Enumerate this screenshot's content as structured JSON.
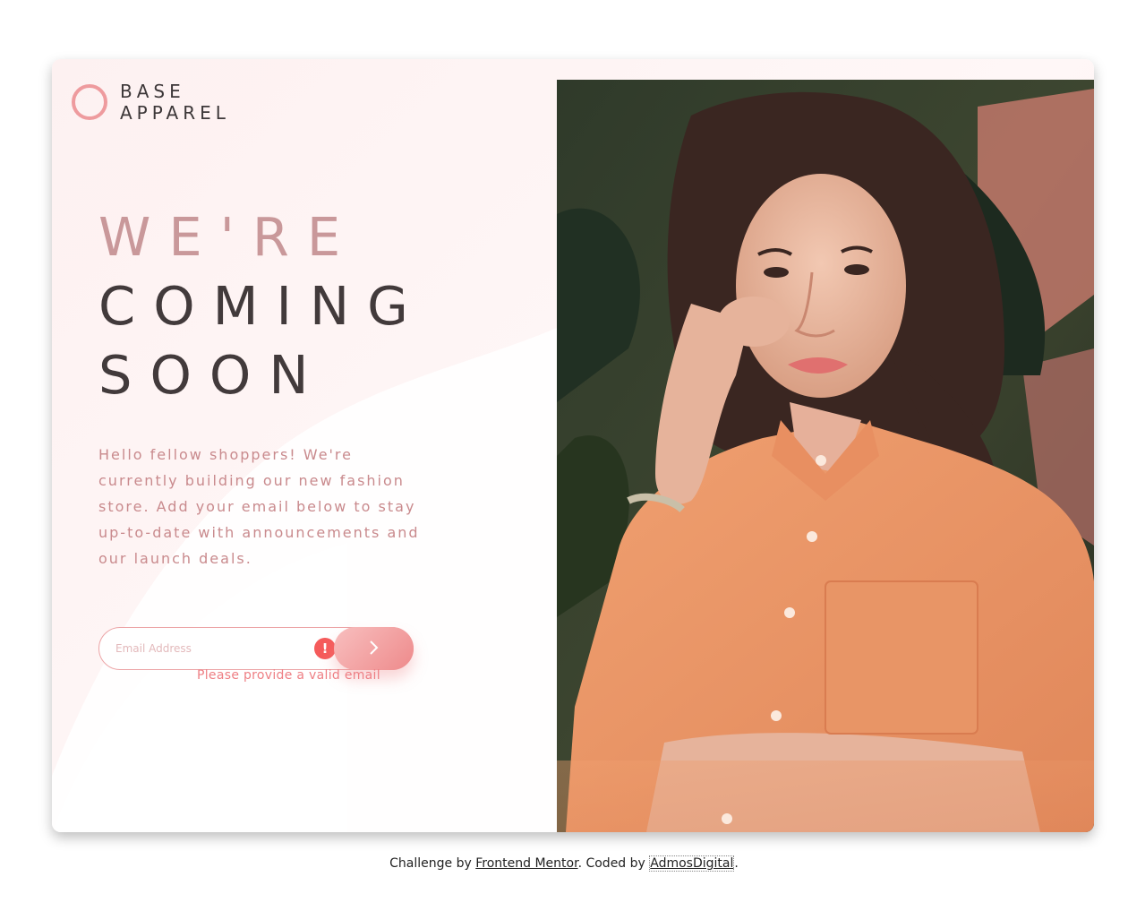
{
  "brand": {
    "line1": "BASE",
    "line2": "APPAREL"
  },
  "headline": {
    "line1": "WE'RE",
    "line2": "COMING",
    "line3": "SOON"
  },
  "intro_text": "Hello fellow shoppers! We're currently building our new fashion store. Add your email below to stay up-to-date with announcements and our launch deals.",
  "form": {
    "email_placeholder": "Email Address",
    "error_icon_text": "!",
    "submit_icon": "chevron-right-icon",
    "error_message": "Please provide a valid email"
  },
  "footer": {
    "prefix": "Challenge by",
    "link1": "Frontend Mentor",
    "middle": ". Coded by",
    "link2": "AdmosDigital",
    "suffix": "."
  },
  "colors": {
    "accent_pink": "#ee9b9e",
    "headline_light": "#c9989a",
    "headline_dark": "#423a3b",
    "error_red": "#f55b5b"
  }
}
